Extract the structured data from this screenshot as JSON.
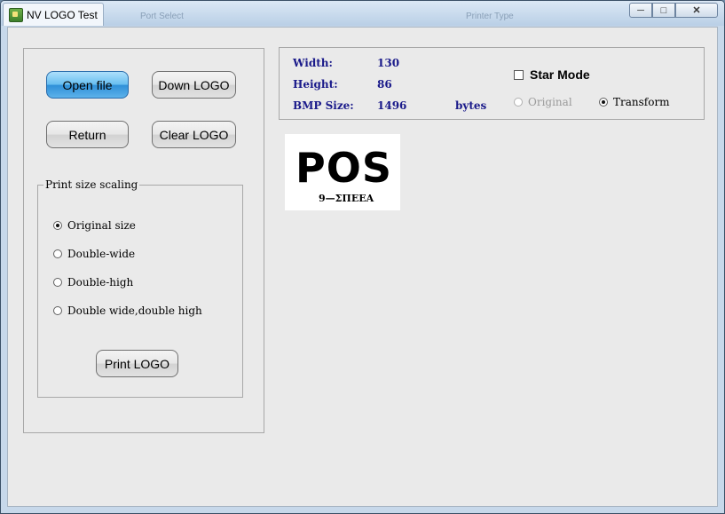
{
  "window": {
    "title": "NV LOGO Test",
    "bg_hints": [
      "Port Select",
      "Printer Type"
    ]
  },
  "buttons": {
    "open_file": "Open file",
    "down_logo": "Down LOGO",
    "return": "Return",
    "clear_logo": "Clear LOGO",
    "print_logo": "Print LOGO"
  },
  "scaling": {
    "title": "Print size scaling",
    "options": [
      "Original size",
      "Double-wide",
      "Double-high",
      "Double wide,double high"
    ],
    "selected": "Original size"
  },
  "info": {
    "width_label": "Width:",
    "width_value": "130",
    "height_label": "Height:",
    "height_value": "86",
    "bmp_label": "BMP Size:",
    "bmp_value": "1496",
    "bmp_unit": "bytes"
  },
  "mode": {
    "star_label": "Star Mode",
    "star_checked": false,
    "original_label": "Original",
    "transform_label": "Transform",
    "selected": "Transform"
  },
  "logo": {
    "text": "POS",
    "subtext": "9—ΣΠΕΕΑ"
  },
  "colors": {
    "info_text": "#1a1a8a",
    "primary_button": "#3a9be0"
  }
}
